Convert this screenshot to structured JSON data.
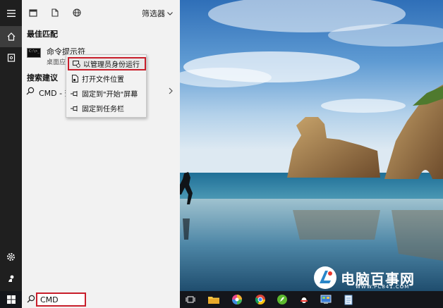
{
  "panel": {
    "filter_label": "筛选器",
    "best_match_title": "最佳匹配",
    "best_match": {
      "title": "命令提示符",
      "subtitle": "桌面应"
    },
    "suggestions_title": "搜索建议",
    "suggestion": {
      "text": "CMD - 查"
    }
  },
  "context_menu": {
    "items": [
      {
        "label": "以管理员身份运行",
        "icon": "run-as-admin-icon"
      },
      {
        "label": "打开文件位置",
        "icon": "file-location-icon"
      },
      {
        "label": "固定到\"开始\"屏幕",
        "icon": "pin-icon"
      },
      {
        "label": "固定到任务栏",
        "icon": "pin-icon"
      }
    ]
  },
  "taskbar": {
    "search_value": "CMD",
    "apps": [
      "task-view-icon",
      "file-explorer-icon",
      "colorful-app-icon",
      "chrome-icon",
      "green-app-icon",
      "qq-icon",
      "control-panel-icon",
      "notepad-icon"
    ]
  },
  "watermark": {
    "text": "电脑百事网",
    "url": "WWW.PC841.COM"
  },
  "colors": {
    "accent_red": "#c81e2b",
    "rail": "#1f1f1f",
    "panel": "#f2f2f2",
    "taskbar": "#14161b"
  }
}
